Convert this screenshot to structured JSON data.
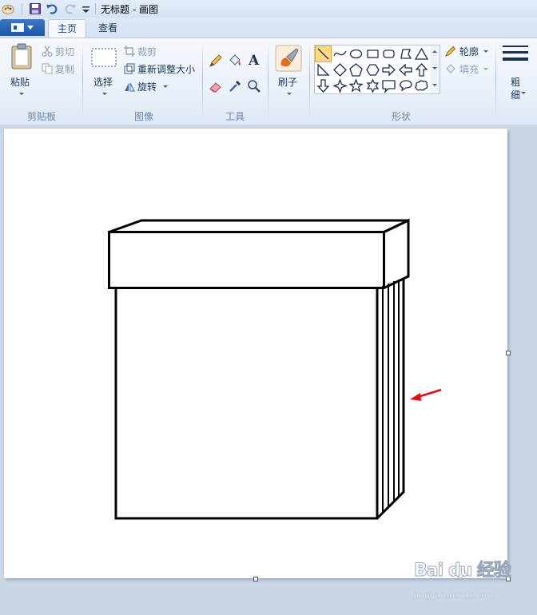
{
  "window": {
    "title": "无标题 - 画图"
  },
  "tabs": {
    "home": "主页",
    "view": "查看"
  },
  "clipboard": {
    "paste": "粘贴",
    "cut": "剪切",
    "copy": "复制",
    "group": "剪贴板"
  },
  "image": {
    "select": "选择",
    "crop": "裁剪",
    "resize": "重新调整大小",
    "rotate": "旋转",
    "group": "图像"
  },
  "tools": {
    "group": "工具",
    "text_glyph": "A"
  },
  "brushes": {
    "label": "刷子"
  },
  "shapes": {
    "outline": "轮廓",
    "fill": "填充",
    "group": "形状"
  },
  "size": {
    "label_line1": "粗",
    "label_line2": "细"
  },
  "watermark": {
    "brand": "Bai du 经验",
    "url": "jingyan.baidu.com"
  },
  "colors": {
    "selected_shape": "#fbd988",
    "arrow": "#e01010",
    "file_button": "#1d57a8"
  }
}
